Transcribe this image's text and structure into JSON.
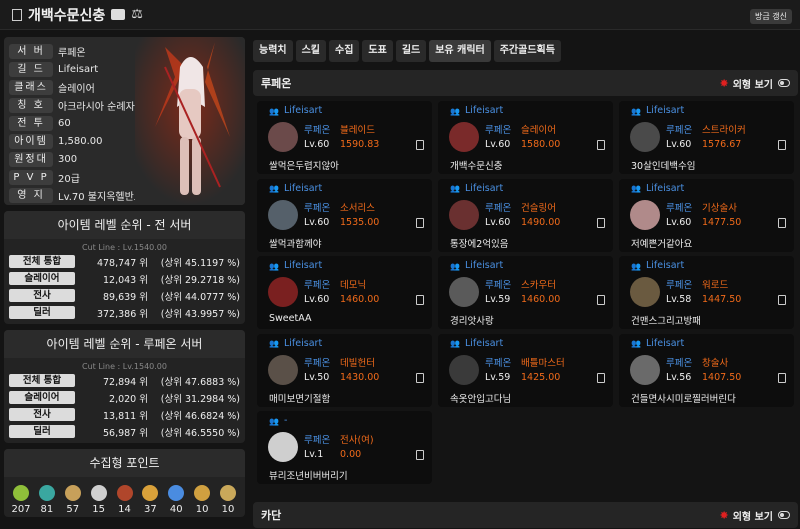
{
  "header": {
    "title": "개백수문신충",
    "refresh_label": "방금 갱신"
  },
  "info": [
    {
      "label": "서 버",
      "value": "루페온"
    },
    {
      "label": "길 드",
      "value": "Lifeisart"
    },
    {
      "label": "클래스",
      "value": "슬레이어"
    },
    {
      "label": "칭 호",
      "value": "아크라시아 순례자"
    },
    {
      "label": "전 투",
      "value": "60"
    },
    {
      "label": "아이템",
      "value": "1,580.00"
    },
    {
      "label": "원정대",
      "value": "300"
    },
    {
      "label": "P V P",
      "value": "20급"
    },
    {
      "label": "영 지",
      "value": "Lv.70 불지옥헬반도"
    }
  ],
  "rank_all": {
    "title": "아이템 레벨 순위 - 전 서버",
    "cut": "Cut Line : Lv.1540.00",
    "rows": [
      {
        "label": "전체 통합",
        "rank": "478,747 위",
        "pct": "(상위 45.1197 %)"
      },
      {
        "label": "슬레이어",
        "rank": "12,043 위",
        "pct": "(상위 29.2718 %)"
      },
      {
        "label": "전사",
        "rank": "89,639 위",
        "pct": "(상위 44.0777 %)"
      },
      {
        "label": "딜러",
        "rank": "372,386 위",
        "pct": "(상위 43.9957 %)"
      }
    ]
  },
  "rank_server": {
    "title": "아이템 레벨 순위 - 루페온 서버",
    "cut": "Cut Line : Lv.1540.00",
    "rows": [
      {
        "label": "전체 통합",
        "rank": "72,894 위",
        "pct": "(상위 47.6883 %)"
      },
      {
        "label": "슬레이어",
        "rank": "2,020 위",
        "pct": "(상위 31.2984 %)"
      },
      {
        "label": "전사",
        "rank": "13,811 위",
        "pct": "(상위 46.6824 %)"
      },
      {
        "label": "딜러",
        "rank": "56,987 위",
        "pct": "(상위 46.5550 %)"
      }
    ]
  },
  "collect": {
    "title": "수집형 포인트",
    "items": [
      {
        "icon": "seed-icon",
        "count": "207",
        "color": "#8fbf3a"
      },
      {
        "icon": "island-heart-icon",
        "count": "81",
        "color": "#3aa7a0"
      },
      {
        "icon": "painting-icon",
        "count": "57",
        "color": "#c7a05a"
      },
      {
        "icon": "mokoko-icon",
        "count": "15",
        "color": "#cfcfcf"
      },
      {
        "icon": "giant-heart-icon",
        "count": "14",
        "color": "#b0462b"
      },
      {
        "icon": "voyage-icon",
        "count": "37",
        "color": "#d9a13a"
      },
      {
        "icon": "star-icon",
        "count": "40",
        "color": "#4a8ce0"
      },
      {
        "icon": "orpheus-icon",
        "count": "10",
        "color": "#d0a040"
      },
      {
        "icon": "medal-icon",
        "count": "10",
        "color": "#c9a85a"
      }
    ]
  },
  "tabs": [
    "능력치",
    "스킬",
    "수집",
    "도표",
    "길드",
    "보유 캐릭터",
    "주간골드획득"
  ],
  "active_tab": 5,
  "section1": {
    "name": "루페온",
    "toggle_label": "외형 보기"
  },
  "section2": {
    "name": "카단",
    "toggle_label": "외형 보기"
  },
  "characters": [
    {
      "guild": "Lifeisart",
      "server": "루페온",
      "cls": "블레이드",
      "lv": "Lv.60",
      "ilvl": "1590.83",
      "name": "쌀먹은두렵지않아",
      "av": "#6b4a4a"
    },
    {
      "guild": "Lifeisart",
      "server": "루페온",
      "cls": "슬레이어",
      "lv": "Lv.60",
      "ilvl": "1580.00",
      "name": "개백수문신충",
      "av": "#7a2a2a"
    },
    {
      "guild": "Lifeisart",
      "server": "루페온",
      "cls": "스트라이커",
      "lv": "Lv.60",
      "ilvl": "1576.67",
      "name": "30살인데백수임",
      "av": "#4a4a4a"
    },
    {
      "guild": "Lifeisart",
      "server": "루페온",
      "cls": "소서리스",
      "lv": "Lv.60",
      "ilvl": "1535.00",
      "name": "쌀먹과함께야",
      "av": "#55606a"
    },
    {
      "guild": "Lifeisart",
      "server": "루페온",
      "cls": "건슬링어",
      "lv": "Lv.60",
      "ilvl": "1490.00",
      "name": "통장에2억있음",
      "av": "#6a3030"
    },
    {
      "guild": "Lifeisart",
      "server": "루페온",
      "cls": "기상술사",
      "lv": "Lv.60",
      "ilvl": "1477.50",
      "name": "저예쁜거같아요",
      "av": "#b08a8a"
    },
    {
      "guild": "Lifeisart",
      "server": "루페온",
      "cls": "데모닉",
      "lv": "Lv.60",
      "ilvl": "1460.00",
      "name": "SweetAA",
      "av": "#7a2020"
    },
    {
      "guild": "Lifeisart",
      "server": "루페온",
      "cls": "스카우터",
      "lv": "Lv.59",
      "ilvl": "1460.00",
      "name": "경리앗사랑",
      "av": "#5a5a5a"
    },
    {
      "guild": "Lifeisart",
      "server": "루페온",
      "cls": "워로드",
      "lv": "Lv.58",
      "ilvl": "1447.50",
      "name": "건맨스그리고방패",
      "av": "#6a5a40"
    },
    {
      "guild": "Lifeisart",
      "server": "루페온",
      "cls": "데빌헌터",
      "lv": "Lv.50",
      "ilvl": "1430.00",
      "name": "매미보면기절함",
      "av": "#5a5048"
    },
    {
      "guild": "Lifeisart",
      "server": "루페온",
      "cls": "배틀마스터",
      "lv": "Lv.59",
      "ilvl": "1425.00",
      "name": "속옷안입고다님",
      "av": "#3a3a3a"
    },
    {
      "guild": "Lifeisart",
      "server": "루페온",
      "cls": "창술사",
      "lv": "Lv.56",
      "ilvl": "1407.50",
      "name": "건들면사시미로찔러버린다",
      "av": "#6a6a6a"
    },
    {
      "guild": "-",
      "server": "루페온",
      "cls": "전사(여)",
      "lv": "Lv.1",
      "ilvl": "0.00",
      "name": "뷰리조년비버버리기",
      "av": "#cfcfcf"
    }
  ]
}
